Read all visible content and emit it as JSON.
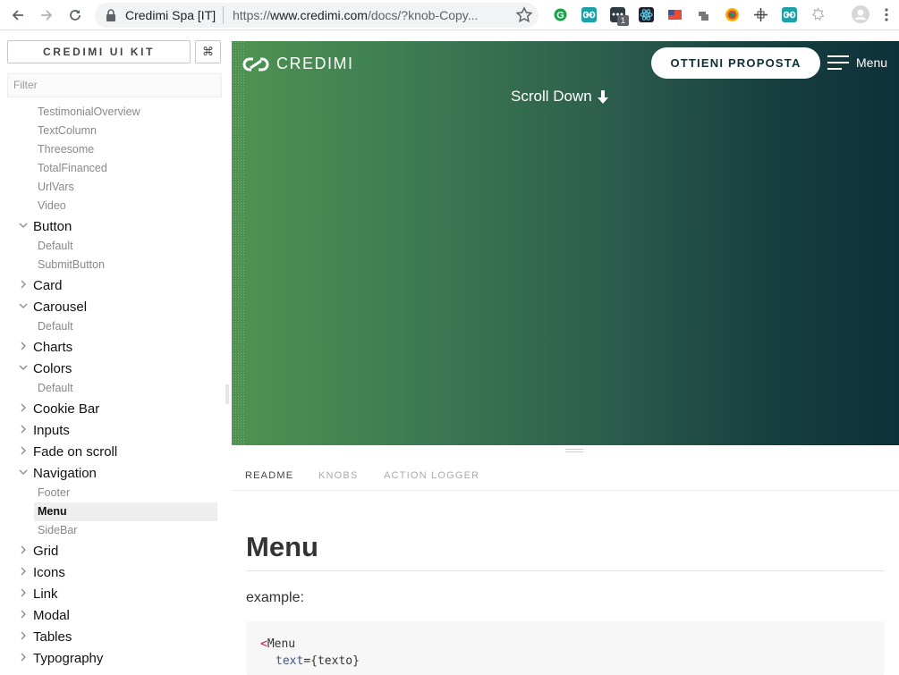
{
  "browser": {
    "site_name": "Credimi Spa [IT]",
    "url_prefix": "https://",
    "url_host": "www.credimi.com",
    "url_path": "/docs/?knob-Copy...",
    "ext_badge": "1"
  },
  "sidebar": {
    "title": "CREDIMI UI KIT",
    "shortcut": "⌘",
    "filter_placeholder": "Filter",
    "items": [
      {
        "type": "story",
        "label": "TestimonialOverview"
      },
      {
        "type": "story",
        "label": "TextColumn"
      },
      {
        "type": "story",
        "label": "Threesome"
      },
      {
        "type": "story",
        "label": "TotalFinanced"
      },
      {
        "type": "story",
        "label": "UrlVars"
      },
      {
        "type": "story",
        "label": "Video"
      },
      {
        "type": "kind",
        "label": "Button",
        "expanded": true
      },
      {
        "type": "story",
        "label": "Default"
      },
      {
        "type": "story",
        "label": "SubmitButton"
      },
      {
        "type": "kind",
        "label": "Card",
        "expanded": false
      },
      {
        "type": "kind",
        "label": "Carousel",
        "expanded": true
      },
      {
        "type": "story",
        "label": "Default"
      },
      {
        "type": "kind",
        "label": "Charts",
        "expanded": false
      },
      {
        "type": "kind",
        "label": "Colors",
        "expanded": true
      },
      {
        "type": "story",
        "label": "Default"
      },
      {
        "type": "kind",
        "label": "Cookie Bar",
        "expanded": false
      },
      {
        "type": "kind",
        "label": "Inputs",
        "expanded": false
      },
      {
        "type": "kind",
        "label": "Fade on scroll",
        "expanded": false
      },
      {
        "type": "kind",
        "label": "Navigation",
        "expanded": true
      },
      {
        "type": "story",
        "label": "Footer"
      },
      {
        "type": "story",
        "label": "Menu",
        "selected": true
      },
      {
        "type": "story",
        "label": "SideBar"
      },
      {
        "type": "kind",
        "label": "Grid",
        "expanded": false
      },
      {
        "type": "kind",
        "label": "Icons",
        "expanded": false
      },
      {
        "type": "kind",
        "label": "Link",
        "expanded": false
      },
      {
        "type": "kind",
        "label": "Modal",
        "expanded": false
      },
      {
        "type": "kind",
        "label": "Tables",
        "expanded": false
      },
      {
        "type": "kind",
        "label": "Typography",
        "expanded": false
      }
    ]
  },
  "preview": {
    "brand": "CREDIMI",
    "cta": "OTTIENI PROPOSTA",
    "menu_label": "Menu",
    "scroll_down": "Scroll Down"
  },
  "panel": {
    "tabs": [
      "README",
      "KNOBS",
      "ACTION LOGGER"
    ],
    "active_tab": "README",
    "title": "Menu",
    "example_label": "example:",
    "code_tag": "Menu",
    "code_attr": "text",
    "code_value": "texto"
  },
  "colors": {
    "gradient_left": "#4e9352",
    "gradient_right": "#0e303a",
    "cta_text": "#0f2e38"
  }
}
